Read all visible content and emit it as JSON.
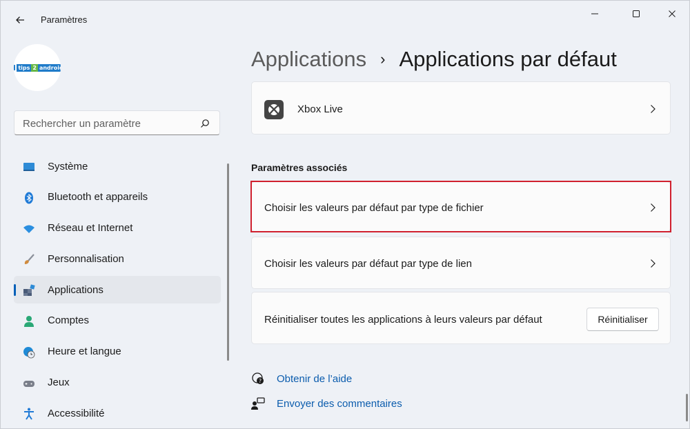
{
  "window": {
    "title": "Paramètres",
    "back_icon": "arrow-left-icon",
    "controls": [
      "minimize-icon",
      "maximize-icon",
      "close-icon"
    ]
  },
  "profile": {
    "logo_text": [
      "tips",
      "2",
      "android"
    ]
  },
  "search": {
    "placeholder": "Rechercher un paramètre",
    "icon": "search-icon"
  },
  "sidebar": {
    "items": [
      {
        "label": "Système",
        "icon": "system-icon",
        "color": "#2e8bd6"
      },
      {
        "label": "Bluetooth et appareils",
        "icon": "bluetooth-icon",
        "color": "#1f7ad6"
      },
      {
        "label": "Réseau et Internet",
        "icon": "wifi-icon",
        "color": "#2b8fe0"
      },
      {
        "label": "Personnalisation",
        "icon": "brush-icon",
        "color": "#d08b3e"
      },
      {
        "label": "Applications",
        "icon": "apps-icon",
        "color": "#4a5b78",
        "active": true
      },
      {
        "label": "Comptes",
        "icon": "account-icon",
        "color": "#2aa876"
      },
      {
        "label": "Heure et langue",
        "icon": "globe-clock-icon",
        "color": "#1f8ad6"
      },
      {
        "label": "Jeux",
        "icon": "gamepad-icon",
        "color": "#7a7f8a"
      },
      {
        "label": "Accessibilité",
        "icon": "accessibility-icon",
        "color": "#1f7ad6"
      }
    ]
  },
  "breadcrumb": {
    "parent": "Applications",
    "separator": "›",
    "current": "Applications par défaut"
  },
  "main": {
    "xbox_card": {
      "label": "Xbox Live",
      "icon": "xbox-icon"
    },
    "section_title": "Paramètres associés",
    "file_type_card": {
      "label": "Choisir les valeurs par défaut par type de fichier"
    },
    "link_type_card": {
      "label": "Choisir les valeurs par défaut par type de lien"
    },
    "reset_card": {
      "label": "Réinitialiser toutes les applications à leurs valeurs par défaut",
      "button_label": "Réinitialiser"
    },
    "help_link": {
      "label": "Obtenir de l’aide",
      "icon": "help-icon"
    },
    "feedback_link": {
      "label": "Envoyer des commentaires",
      "icon": "feedback-icon"
    }
  },
  "colors": {
    "accent": "#005fb8",
    "highlight": "#d0202e",
    "link": "#0b5cad"
  }
}
